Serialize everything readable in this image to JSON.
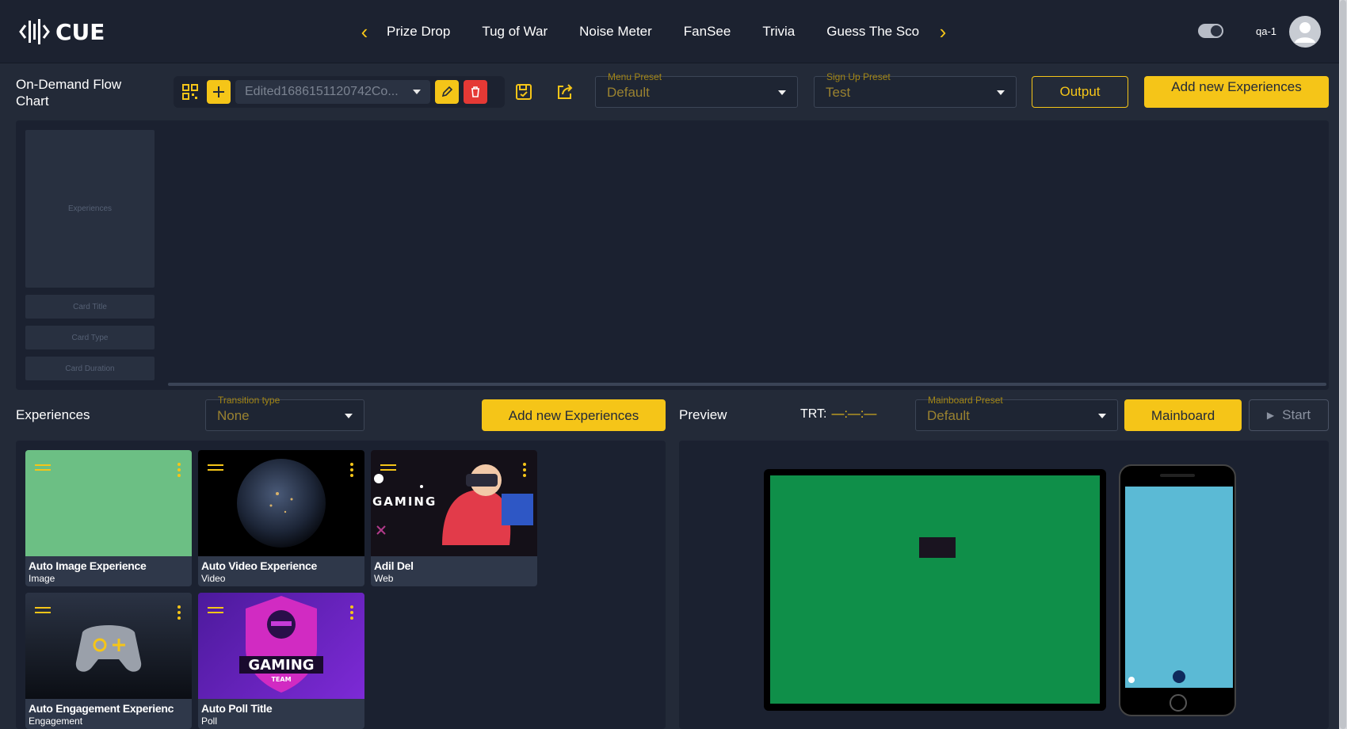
{
  "app": {
    "logo_text": "CUE"
  },
  "nav": {
    "items": [
      "Prize Drop",
      "Tug of War",
      "Noise Meter",
      "FanSee",
      "Trivia",
      "Guess The Sco"
    ]
  },
  "user": {
    "name": "qa-1"
  },
  "flow": {
    "title": "On-Demand Flow Chart",
    "selected_flow": "Edited1686151120742Co...",
    "menu_preset": {
      "label": "Menu Preset",
      "value": "Default"
    },
    "signup_preset": {
      "label": "Sign Up Preset",
      "value": "Test"
    },
    "output_label": "Output",
    "add_new_label": "Add new Experiences",
    "legend": {
      "experiences": "Experiences",
      "card_title": "Card Title",
      "card_type": "Card Type",
      "card_duration": "Card Duration"
    }
  },
  "experiences": {
    "title": "Experiences",
    "transition": {
      "label": "Transition type",
      "value": "None"
    },
    "add_label": "Add new Experiences",
    "cards": [
      {
        "title": "Auto Image Experience",
        "type": "Image",
        "thumb": "green-image"
      },
      {
        "title": "Auto Video Experience",
        "type": "Video",
        "thumb": "earth-image"
      },
      {
        "title": "Adil Del",
        "type": "Web",
        "thumb": "gaming-channel-image"
      },
      {
        "title": "Auto Engagement Experienc",
        "type": "Engagement",
        "thumb": "gamepad-image"
      },
      {
        "title": "Auto Poll Title",
        "type": "Poll",
        "thumb": "gaming-team-image"
      }
    ]
  },
  "preview": {
    "title": "Preview",
    "trt_label": "TRT:",
    "trt_value": "—:—:—",
    "mainboard_preset": {
      "label": "Mainboard Preset",
      "value": "Default"
    },
    "mainboard_label": "Mainboard",
    "start_label": "Start"
  },
  "colors": {
    "accent": "#f5c518",
    "background": "#232a38",
    "danger": "#e53935",
    "tablet_screen": "#0f8f49",
    "phone_screen": "#5bbad5"
  }
}
